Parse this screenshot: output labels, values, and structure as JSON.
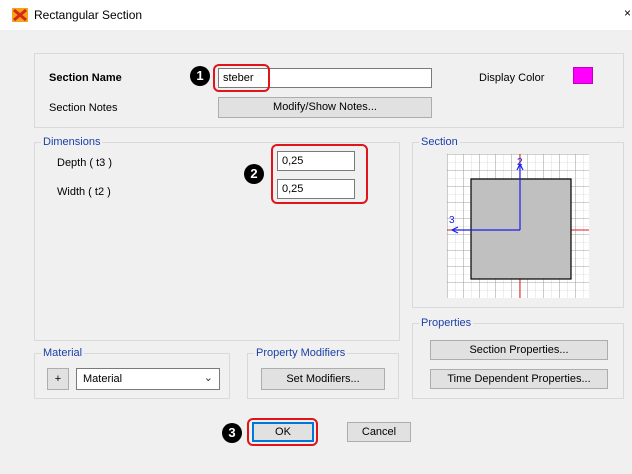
{
  "window": {
    "title": "Rectangular Section",
    "close_symbol": "×",
    "icon": "cross-section-app-icon"
  },
  "section": {
    "name_label": "Section Name",
    "name_value": "steber",
    "notes_label": "Section Notes",
    "notes_button": "Modify/Show Notes...",
    "display_color_label": "Display Color",
    "display_color": "#ff00ff"
  },
  "dimensions": {
    "group_label": "Dimensions",
    "depth_label": "Depth  ( t3 )",
    "depth_value": "0,25",
    "width_label": "Width  ( t2 )",
    "width_value": "0,25"
  },
  "preview": {
    "group_label": "Section",
    "axis_2_label": "2",
    "axis_3_label": "3"
  },
  "properties": {
    "group_label": "Properties",
    "section_properties_button": "Section Properties...",
    "time_dependent_button": "Time Dependent Properties..."
  },
  "material": {
    "group_label": "Material",
    "add_button": "+",
    "selected": "Material"
  },
  "modifiers": {
    "group_label": "Property Modifiers",
    "set_button": "Set Modifiers..."
  },
  "buttons": {
    "ok": "OK",
    "cancel": "Cancel"
  },
  "callouts": {
    "step1": "1",
    "step2": "2",
    "step3": "3",
    "color": "#e0151b"
  }
}
